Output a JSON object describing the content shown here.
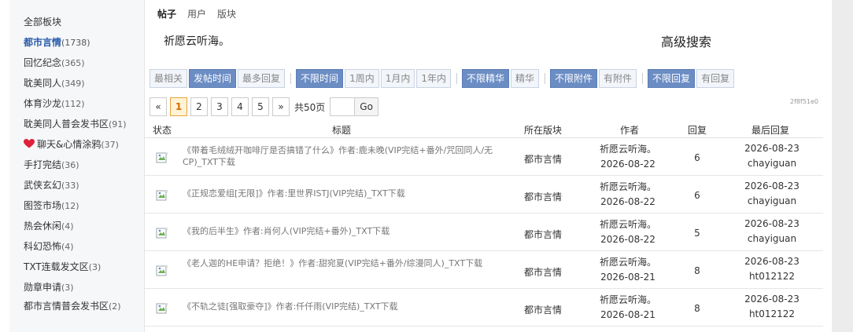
{
  "sidebar": {
    "items": [
      {
        "label": "全部板块",
        "count": ""
      },
      {
        "label": "都市言情",
        "count": "(1738)"
      },
      {
        "label": "回忆纪念",
        "count": "(365)"
      },
      {
        "label": "耽美同人",
        "count": "(349)"
      },
      {
        "label": "体育沙龙",
        "count": "(112)"
      },
      {
        "label": "耽美同人普会发书区",
        "count": "(91)"
      },
      {
        "label": "聊天&心情涂鸦",
        "count": "(37)"
      },
      {
        "label": "手打完结",
        "count": "(36)"
      },
      {
        "label": "武侠玄幻",
        "count": "(33)"
      },
      {
        "label": "图签市场",
        "count": "(12)"
      },
      {
        "label": "热会休闲",
        "count": "(4)"
      },
      {
        "label": "科幻恐怖",
        "count": "(4)"
      },
      {
        "label": "TXT连载发文区",
        "count": "(3)"
      },
      {
        "label": "勋章申请",
        "count": "(3)"
      },
      {
        "label": "都市言情普会发书区",
        "count": "(2)"
      }
    ]
  },
  "search": {
    "tabs": [
      "帖子",
      "用户",
      "版块"
    ],
    "keyword": "祈愿云听海。",
    "advanced_label": "高级搜索"
  },
  "filters": {
    "sort": [
      "最相关",
      "发帖时间",
      "最多回复"
    ],
    "time": [
      "不限时间",
      "1周内",
      "1月内",
      "1年内"
    ],
    "digest": [
      "不限精华",
      "精华"
    ],
    "attach": [
      "不限附件",
      "有附件"
    ],
    "reply": [
      "不限回复",
      "有回复"
    ]
  },
  "pager": {
    "prev": "«",
    "pages": [
      "1",
      "2",
      "3",
      "4",
      "5"
    ],
    "next": "»",
    "total": "共50页",
    "go": "Go",
    "code": "2f8f51e0"
  },
  "table": {
    "headers": [
      "状态",
      "标题",
      "所在版块",
      "作者",
      "回复",
      "最后回复"
    ],
    "rows": [
      {
        "title": "《带着毛绒绒开咖啡厅是否搞错了什么》作者:鹿未晚(VIP完结+番外/咒回同人/无CP)_TXT下载",
        "forum": "都市言情",
        "author": "祈愿云听海。",
        "date": "2026-08-22",
        "replies": "6",
        "last_date": "2026-08-23",
        "last_user": "chayiguan"
      },
      {
        "title": "《正规恋爱组[无限]》作者:里世界ISTJ(VIP完结)_TXT下载",
        "forum": "都市言情",
        "author": "祈愿云听海。",
        "date": "2026-08-22",
        "replies": "6",
        "last_date": "2026-08-23",
        "last_user": "chayiguan"
      },
      {
        "title": "《我的后半生》作者:肖何人(VIP完结+番外)_TXT下载",
        "forum": "都市言情",
        "author": "祈愿云听海。",
        "date": "2026-08-22",
        "replies": "5",
        "last_date": "2026-08-23",
        "last_user": "chayiguan"
      },
      {
        "title": "《老人迦的HE申请？拒绝！》作者:甜宛夏(VIP完结+番外/综漫同人)_TXT下载",
        "forum": "都市言情",
        "author": "祈愿云听海。",
        "date": "2026-08-21",
        "replies": "8",
        "last_date": "2026-08-23",
        "last_user": "ht012122"
      },
      {
        "title": "《不轨之徒[强取豪夺]》作者:仟仟雨(VIP完结)_TXT下载",
        "forum": "都市言情",
        "author": "祈愿云听海。",
        "date": "2026-08-21",
        "replies": "8",
        "last_date": "2026-08-23",
        "last_user": "ht012122"
      }
    ]
  },
  "icons": {
    "status": "broken-image-icon",
    "heart": "heart-icon"
  },
  "colors": {
    "active_filter": "#6b8dc4",
    "link_active": "#2a5daa",
    "heart": "#e0213a",
    "current_page": "#e8a33d"
  }
}
